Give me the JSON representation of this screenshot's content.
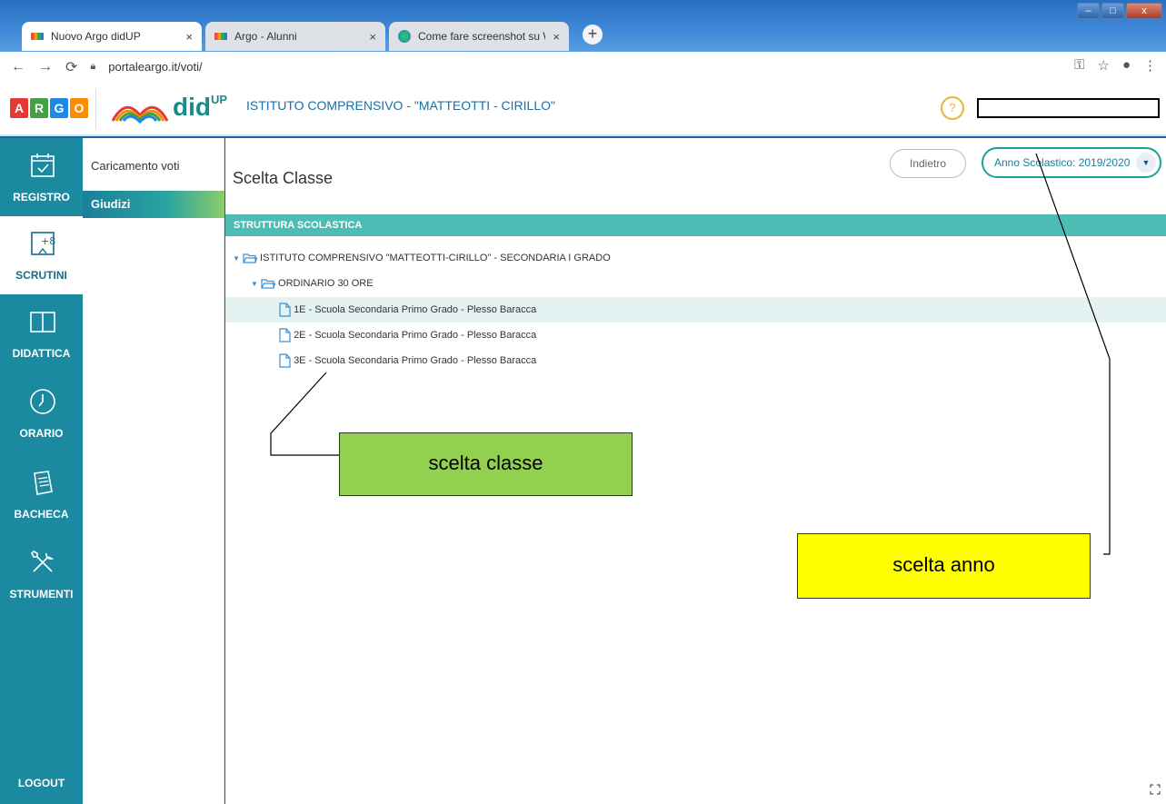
{
  "browser": {
    "tabs": [
      {
        "title": "Nuovo Argo didUP",
        "active": true
      },
      {
        "title": "Argo - Alunni",
        "active": false
      },
      {
        "title": "Come fare screenshot su Window",
        "active": false
      }
    ],
    "url": "portaleargo.it/voti/",
    "close_symbol": "×",
    "new_tab_symbol": "+",
    "window_buttons": [
      "–",
      "□",
      "x"
    ]
  },
  "header": {
    "argo_letters": [
      "A",
      "R",
      "G",
      "O"
    ],
    "argo_colors": [
      "#e53935",
      "#43a047",
      "#1e88e5",
      "#fb8c00"
    ],
    "product": "did",
    "product_sup": "UP",
    "school_name": "ISTITUTO COMPRENSIVO - \"MATTEOTTI - CIRILLO\"",
    "help_symbol": "?"
  },
  "sidebar": {
    "items": [
      {
        "label": "REGISTRO",
        "icon": "calendar-icon"
      },
      {
        "label": "SCRUTINI",
        "icon": "grades-icon",
        "active": true
      },
      {
        "label": "DIDATTICA",
        "icon": "book-icon"
      },
      {
        "label": "ORARIO",
        "icon": "clock-icon"
      },
      {
        "label": "BACHECA",
        "icon": "noticeboard-icon"
      },
      {
        "label": "STRUMENTI",
        "icon": "tools-icon"
      }
    ],
    "logout": "LOGOUT"
  },
  "submenu": {
    "items": [
      {
        "label": "Caricamento voti"
      },
      {
        "label": "Giudizi",
        "active": true
      }
    ]
  },
  "main": {
    "title": "Scelta Classe",
    "back_label": "Indietro",
    "year_label": "Anno Scolastico: 2019/2020",
    "section_header": "STRUTTURA SCOLASTICA",
    "tree": {
      "root": "ISTITUTO COMPRENSIVO \"MATTEOTTI-CIRILLO\" - SECONDARIA I GRADO",
      "group": "ORDINARIO 30 ORE",
      "classes": [
        "1E - Scuola Secondaria Primo Grado - Plesso Baracca",
        "2E - Scuola Secondaria Primo Grado - Plesso Baracca",
        "3E - Scuola Secondaria Primo Grado - Plesso Baracca"
      ]
    }
  },
  "annotations": {
    "class_callout": "scelta  classe",
    "year_callout": "scelta anno",
    "class_callout_color": "#92d050",
    "year_callout_color": "#ffff00"
  },
  "colors": {
    "sidebar": "#1b8aa0",
    "accent": "#4cbcb4"
  }
}
